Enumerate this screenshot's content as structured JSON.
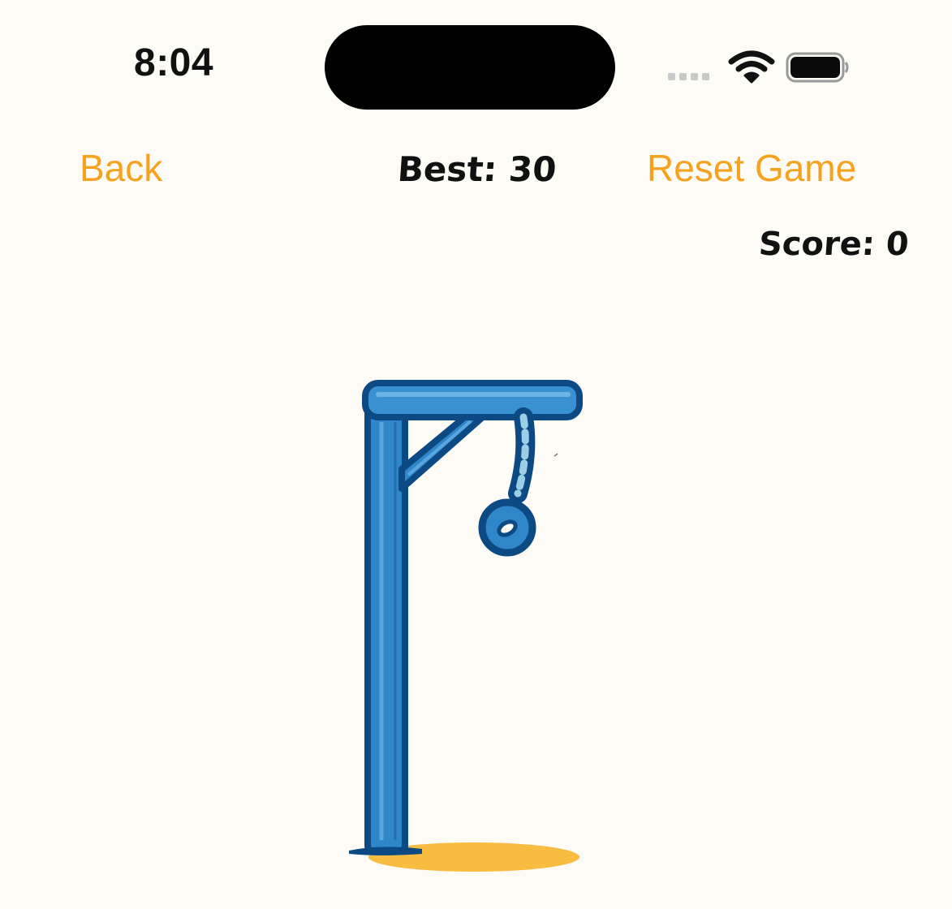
{
  "status_bar": {
    "time": "8:04",
    "icons": [
      "cellular-signal-icon",
      "wifi-icon",
      "battery-icon"
    ]
  },
  "nav": {
    "back_label": "Back",
    "best_label": "Best: 30",
    "reset_label": "Reset Game"
  },
  "game": {
    "score_label": "Score: 0",
    "drawing": "gallows-with-noose",
    "colors": {
      "accent": "#f5a21f",
      "post": "#2f86c8",
      "post_outline": "#0d4a84",
      "shadow": "#f7b52c",
      "background": "#fcfbf6"
    }
  }
}
